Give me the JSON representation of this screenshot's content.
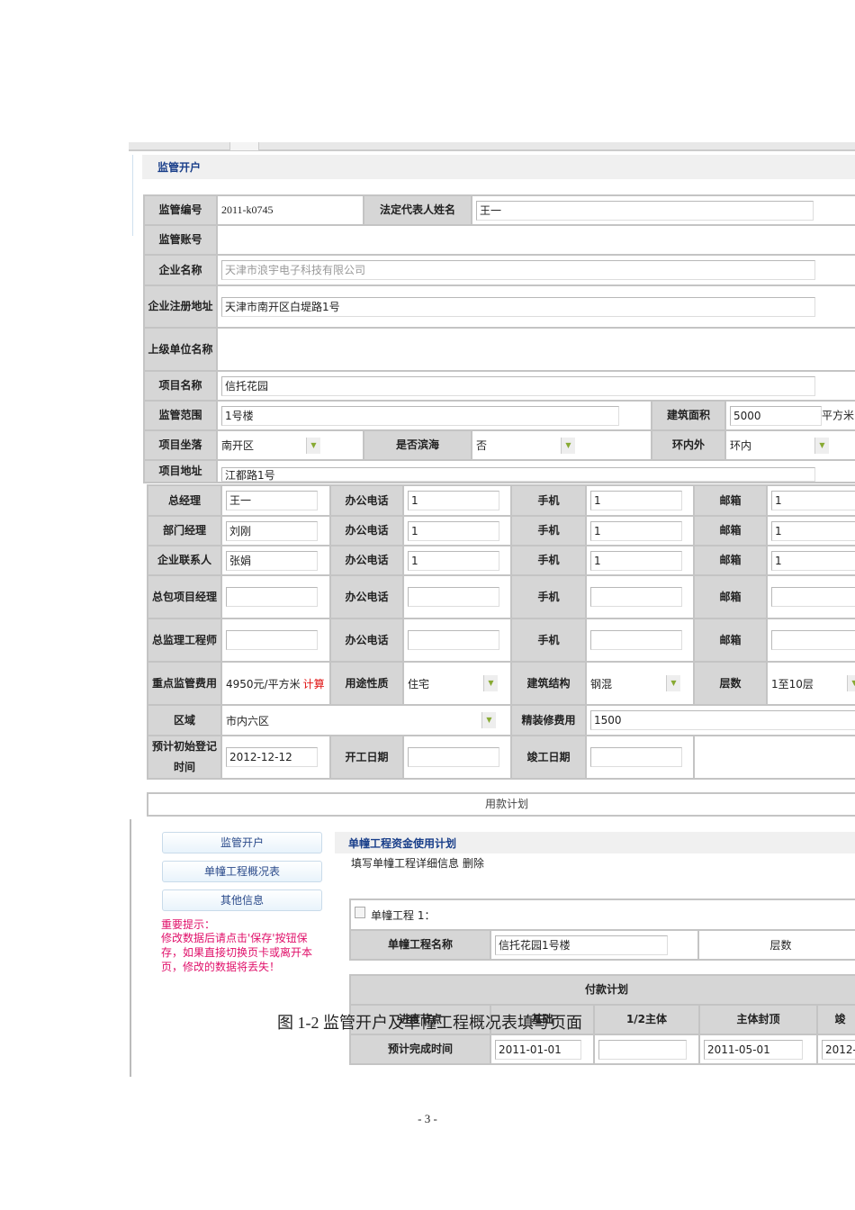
{
  "top": {
    "header": "监管开户",
    "rows": {
      "reg_no_label": "监管编号",
      "reg_no": "2011-k0745",
      "legal_rep_label": "法定代表人姓名",
      "legal_rep": "王一",
      "account_label": "监管账号",
      "company_label": "企业名称",
      "company": "天津市浪宇电子科技有限公司",
      "reg_addr_label": "企业注册地址",
      "reg_addr": "天津市南开区白堤路1号",
      "parent_label": "上级单位名称",
      "project_label": "项目名称",
      "project": "信托花园",
      "scope_label": "监管范围",
      "scope": "1号楼",
      "area_label": "建筑面积",
      "area": "5000",
      "area_unit": "平方米",
      "location_label": "项目坐落",
      "location": "南开区",
      "binhai_label": "是否滨海",
      "binhai": "否",
      "ring_label": "环内外",
      "ring": "环内",
      "addr_label": "项目地址",
      "addr": "江都路1号"
    }
  },
  "contacts": {
    "office_label": "办公电话",
    "mobile_label": "手机",
    "email_label": "邮箱",
    "rows": [
      {
        "role": "总经理",
        "name": "王一",
        "office": "1",
        "mobile": "1",
        "email": "1"
      },
      {
        "role": "部门经理",
        "name": "刘刚",
        "office": "1",
        "mobile": "1",
        "email": "1"
      },
      {
        "role": "企业联系人",
        "name": "张娟",
        "office": "1",
        "mobile": "1",
        "email": "1"
      },
      {
        "role": "总包项目经理",
        "name": "",
        "office": "",
        "mobile": "",
        "email": ""
      },
      {
        "role": "总监理工程师",
        "name": "",
        "office": "",
        "mobile": "",
        "email": ""
      }
    ],
    "fee_label": "重点监管费用",
    "fee": "4950元/平方米",
    "calc": "计算",
    "usage_label": "用途性质",
    "usage": "住宅",
    "structure_label": "建筑结构",
    "structure": "钢混",
    "floors_label": "层数",
    "floors": "1至10层",
    "district_label": "区域",
    "district": "市内六区",
    "decor_label": "精装修费用",
    "decor": "1500",
    "reg_time_label": "预计初始登记时间",
    "reg_time": "2012-12-12",
    "start_label": "开工日期",
    "start": "",
    "finish_label": "竣工日期",
    "finish": "",
    "plan_button": "用款计划"
  },
  "bottom": {
    "nav": [
      "监管开户",
      "单幢工程概况表",
      "其他信息"
    ],
    "warning_title": "重要提示：",
    "warning": "修改数据后请点击'保存'按钮保存，如果直接切换页卡或离开本页，修改的数据将丢失！",
    "panel_title": "单幢工程资金使用计划",
    "fill_link": "填写单幢工程详细信息",
    "delete_link": "删除",
    "building_label": "单幢工程 1：",
    "building_name_label": "单幢工程名称",
    "building_name": "信托花园1号楼",
    "floors_label": "层数",
    "pay_title": "付款计划",
    "node_label": "进度节点",
    "nodes": [
      "基础",
      "1/2主体",
      "主体封顶",
      "竣"
    ],
    "time_label": "预计完成时间",
    "times": [
      "2011-01-01",
      "",
      "2011-05-01",
      "2012-"
    ]
  },
  "caption": "图 1-2 监管开户及单幢工程概况表填写页面",
  "page_number": "- 3 -"
}
